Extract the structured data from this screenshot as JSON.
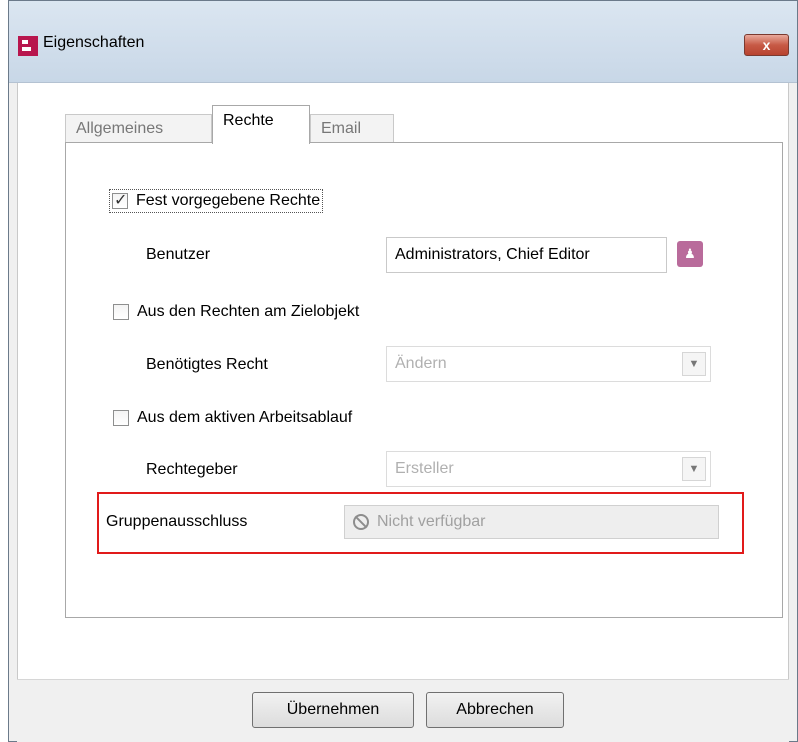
{
  "window": {
    "title": "Eigenschaften",
    "close_symbol": "x"
  },
  "tabs": [
    {
      "label": "Allgemeines",
      "active": false
    },
    {
      "label": "Rechte",
      "active": true
    },
    {
      "label": "Email",
      "active": false
    }
  ],
  "rights": {
    "fixed": {
      "label": "Fest vorgegebene Rechte",
      "checked": true
    },
    "user_label": "Benutzer",
    "user_value": "Administrators, Chief Editor",
    "target": {
      "label": "Aus den Rechten am Zielobjekt",
      "checked": false
    },
    "required_right_label": "Benötigtes Recht",
    "required_right_value": "Ändern",
    "workflow": {
      "label": "Aus dem aktiven Arbeitsablauf",
      "checked": false
    },
    "grantor_label": "Rechtegeber",
    "grantor_value": "Ersteller",
    "group_exclusion_label": "Gruppenausschluss",
    "group_exclusion_value": "Nicht verfügbar"
  },
  "buttons": {
    "apply": "Übernehmen",
    "cancel": "Abbrechen"
  },
  "colors": {
    "highlight": "#e11a1a",
    "brand": "#b8164e"
  }
}
